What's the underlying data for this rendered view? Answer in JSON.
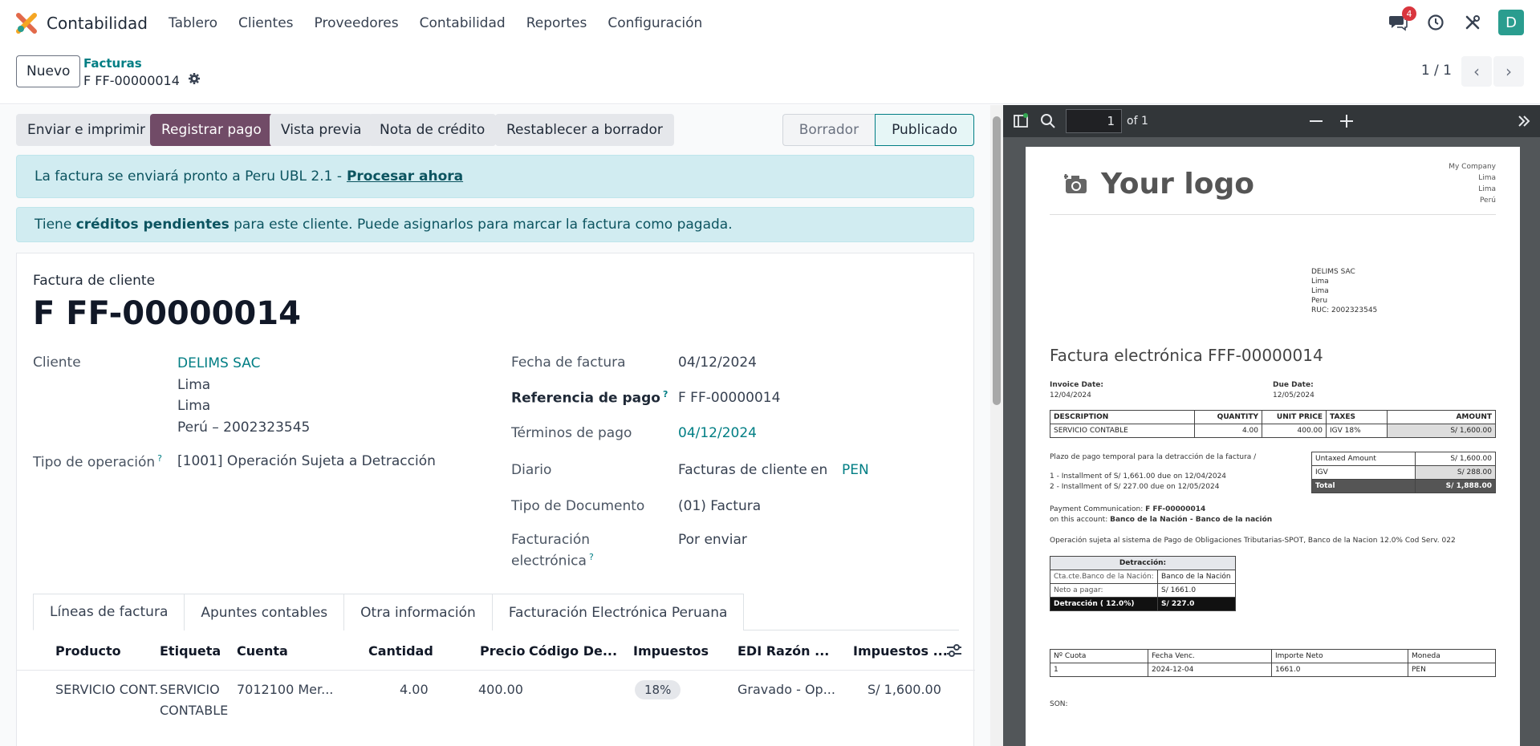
{
  "topnav": {
    "app_title": "Contabilidad",
    "menu": [
      "Tablero",
      "Clientes",
      "Proveedores",
      "Contabilidad",
      "Reportes",
      "Configuración"
    ],
    "chat_count": "4",
    "avatar_letter": "D"
  },
  "control": {
    "new_button": "Nuevo",
    "breadcrumb_parent": "Facturas",
    "breadcrumb_current": "F FF-00000014",
    "pager": "1 / 1"
  },
  "statusbar": {
    "buttons": [
      "Enviar e imprimir",
      "Registrar pago",
      "Vista previa",
      "Nota de crédito",
      "Restablecer a borrador"
    ],
    "states": [
      "Borrador",
      "Publicado"
    ],
    "active_state": "Publicado"
  },
  "alerts": {
    "edi_text": "La factura se enviará pronto a Peru UBL 2.1 -",
    "edi_link": "Procesar ahora",
    "credit_pre": "Tiene",
    "credit_bold": "créditos pendientes",
    "credit_post": "para este cliente. Puede asignarlos para marcar la factura como pagada."
  },
  "form": {
    "type_label": "Factura de cliente",
    "name": "F FF-00000014",
    "customer_label": "Cliente",
    "customer_name": "DELIMS SAC",
    "customer_addr": [
      "Lima",
      "Lima",
      "Perú – 2002323545"
    ],
    "operation_label": "Tipo de operación",
    "operation_value": "[1001] Operación Sujeta a Detracción",
    "invoice_date_label": "Fecha de factura",
    "invoice_date": "04/12/2024",
    "payment_ref_label": "Referencia de pago",
    "payment_ref": "F FF-00000014",
    "terms_label": "Términos de pago",
    "terms": "04/12/2024",
    "journal_label": "Diario",
    "journal": "Facturas de cliente",
    "journal_in": "en",
    "currency": "PEN",
    "doc_type_label": "Tipo de Documento",
    "doc_type": "(01) Factura",
    "einv_label_1": "Facturación",
    "einv_label_2": "electrónica",
    "einv_value": "Por enviar",
    "help_mark": "?"
  },
  "tabs": [
    "Líneas de factura",
    "Apuntes contables",
    "Otra información",
    "Facturación Electrónica Peruana"
  ],
  "lines": {
    "headers": [
      "Producto",
      "Etiqueta",
      "Cuenta",
      "Cantidad",
      "Precio",
      "Código De...",
      "Impuestos",
      "EDI Razón ...",
      "Impuestos ..."
    ],
    "row": {
      "product": "SERVICIO CONT.",
      "label_1": "SERVICIO",
      "label_2": "CONTABLE",
      "account": "7012100 Mer...",
      "qty": "4.00",
      "price": "400.00",
      "tax": "18%",
      "edi": "Gravado - Op...",
      "subtotal": "S/ 1,600.00"
    }
  },
  "pdf": {
    "page_num": "1",
    "of": "of 1",
    "logo_text": "Your logo",
    "company": [
      "My Company",
      "Lima",
      "Lima",
      "Perú"
    ],
    "partner": [
      "DELIMS SAC",
      "Lima",
      "Lima",
      "Peru",
      "RUC: 2002323545"
    ],
    "title": "Factura electrónica FFF-00000014",
    "invoice_date_label": "Invoice Date:",
    "invoice_date": "12/04/2024",
    "due_date_label": "Due Date:",
    "due_date": "12/05/2024",
    "line_headers": [
      "DESCRIPTION",
      "QUANTITY",
      "UNIT PRICE",
      "TAXES",
      "AMOUNT"
    ],
    "line_row": [
      "SERVICIO CONTABLE",
      "4.00",
      "400.00",
      "IGV 18%",
      "S/ 1,600.00"
    ],
    "plazo": "Plazo de pago temporal para la detracción de la factura /",
    "installments": [
      "1 - Installment of S/ 1,661.00 due on 12/04/2024",
      "2 - Installment of S/ 227.00 due on 12/05/2024"
    ],
    "totals": [
      [
        "Untaxed Amount",
        "S/ 1,600.00"
      ],
      [
        "IGV",
        "S/ 288.00"
      ],
      [
        "Total",
        "S/ 1,888.00"
      ]
    ],
    "payment_comm_label": "Payment Communication:",
    "payment_comm": "F FF-00000014",
    "account_label": "on this account:",
    "account": "Banco de la Nación - Banco de la nación",
    "spot": "Operación sujeta al sistema de Pago de Obligaciones Tributarias-SPOT, Banco de la Nacion 12.0% Cod Serv. 022",
    "detraccion_title": "Detracción:",
    "detraccion_rows": [
      [
        "Cta.cte.Banco de la Nación:",
        "Banco de la Nación"
      ],
      [
        "Neto a pagar:",
        "S/ 1661.0"
      ]
    ],
    "detraccion_total": [
      "Detracción ( 12.0%)",
      "S/ 227.0"
    ],
    "quota_headers": [
      "Nº Cuota",
      "Fecha Venc.",
      "Importe Neto",
      "Moneda"
    ],
    "quota_row": [
      "1",
      "2024-12-04",
      "1661.0",
      "PEN"
    ],
    "son": "SON:"
  },
  "colors": {
    "primary": "#714b67",
    "link": "#017e84",
    "alert_bg": "#d1ecf1"
  }
}
